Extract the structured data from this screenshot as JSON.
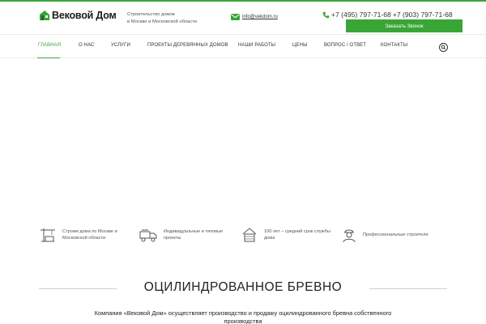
{
  "header": {
    "logo_text": "Вековой Дом",
    "tagline_line1": "Строительство домов",
    "tagline_line2": "в Москве и Московской области",
    "email": "info@vekdom.ru",
    "phone1": "+7 (495) 797-71-68",
    "phone2": "+7 (903) 797-71-68",
    "callback_label": "Заказать Звонок"
  },
  "nav": {
    "items": [
      {
        "label": "ГЛАВНАЯ"
      },
      {
        "label": "О НАС"
      },
      {
        "label": "УСЛУГИ"
      },
      {
        "label": "ПРОЕКТЫ ДЕРЕВЯННЫХ ДОМОВ"
      },
      {
        "label": "НАШИ РАБОТЫ"
      },
      {
        "label": "ЦЕНЫ"
      },
      {
        "label": "ВОПРОС / ОТВЕТ"
      },
      {
        "label": "КОНТАКТЫ"
      }
    ],
    "active_index": 0
  },
  "features": [
    {
      "icon": "crane-icon",
      "line1": "Строим дома по Москве и",
      "line2": "Московской области"
    },
    {
      "icon": "truck-icon",
      "line1": "Индивидуальные и типовые",
      "line2": "проекты"
    },
    {
      "icon": "house-icon",
      "line1": "100 лет – средний срок службы",
      "line2": "дома"
    },
    {
      "icon": "worker-icon",
      "line1": "Профессиональные строители",
      "line2": ""
    }
  ],
  "section": {
    "title": "ОЦИЛИНДРОВАННОЕ БРЕВНО",
    "intro_line1": "Компания «Вековой Дом» осуществляет производство и продажу оцилиндрованного бревна собственного",
    "intro_line2": "производства"
  },
  "colors": {
    "accent": "#3aa537",
    "text": "#333333"
  }
}
